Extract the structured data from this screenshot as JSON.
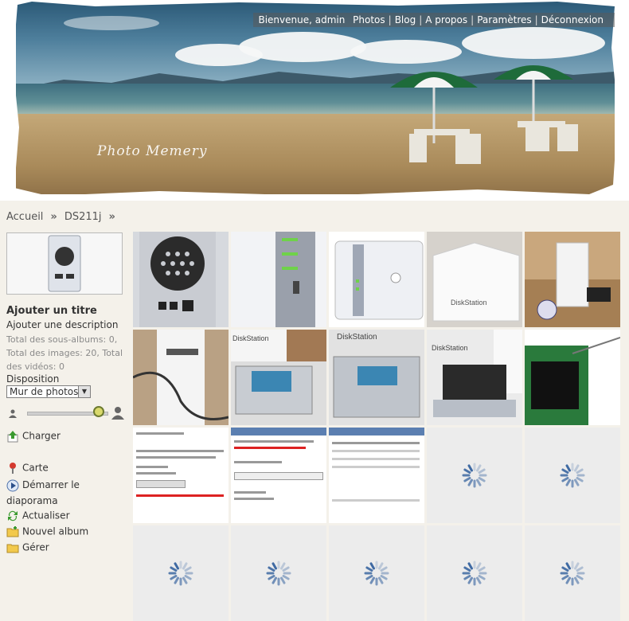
{
  "header": {
    "watermark": "Photo Memery",
    "welcome": "Bienvenue, admin",
    "nav": [
      "Photos",
      "Blog",
      "A propos",
      "Paramètres",
      "Déconnexion"
    ]
  },
  "breadcrumb": [
    "Accueil",
    "DS211j"
  ],
  "sidebar": {
    "title": "Ajouter un titre",
    "description": "Ajouter une description",
    "stats": "Total des sous-albums: 0, Total des images: 20, Total des vidéos: 0",
    "layout_label": "Disposition",
    "layout_value": "Mur de photos",
    "thumb_size_level": 0.9,
    "actions": {
      "upload": "Charger",
      "map": "Carte",
      "slideshow": "Démarrer le diaporama",
      "refresh": "Actualiser",
      "new_album": "Nouvel album",
      "manage": "Gérer"
    }
  },
  "thumbnails": {
    "row1": [
      "nas-back-photo",
      "nas-side-photo",
      "nas-front-photo",
      "diskstation-box-photo",
      "nas-unboxing-photo"
    ],
    "row2": [
      "nas-cable-photo",
      "diskstation-open-photo",
      "diskstation-tray-photo",
      "diskstation-drive-photo",
      "hdd-screw-photo"
    ],
    "row3": [
      "dsm-update-screenshot",
      "dsm-install-screenshot",
      "dsm-settings-screenshot",
      "loading",
      "loading"
    ],
    "row4": [
      "loading",
      "loading",
      "loading",
      "loading",
      "loading"
    ],
    "texts": {
      "diskstation": "DiskStation"
    }
  }
}
